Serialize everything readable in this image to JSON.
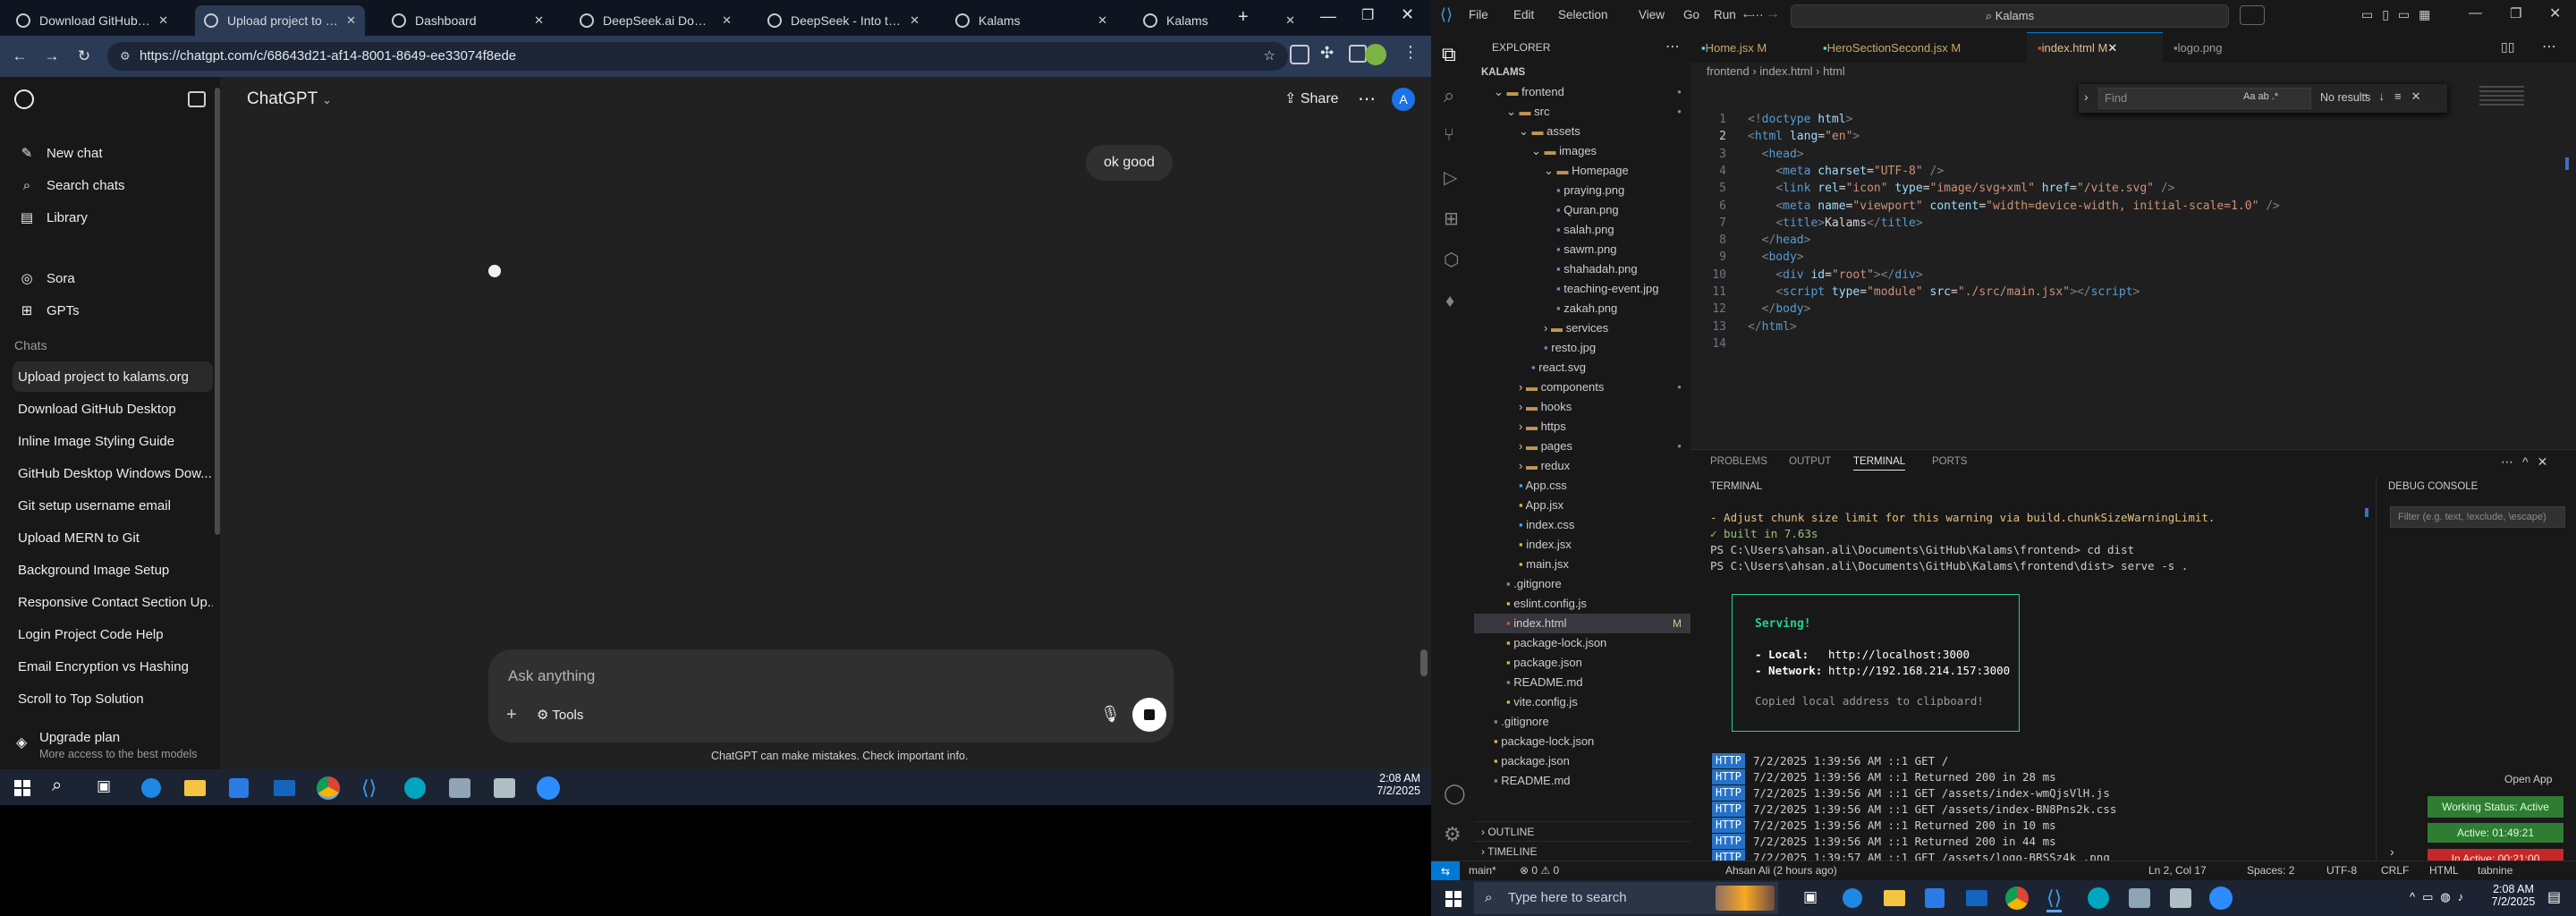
{
  "browser": {
    "tabs": [
      {
        "title": "Download GitHub Des"
      },
      {
        "title": "Upload project to kala",
        "active": true
      },
      {
        "title": "Dashboard"
      },
      {
        "title": "DeepSeek.ai Domain F"
      },
      {
        "title": "DeepSeek - Into the U"
      },
      {
        "title": "Kalams"
      },
      {
        "title": "Kalams"
      }
    ],
    "url": "https://chatgpt.com/c/68643d21-af14-8001-8649-ee33074f8ede"
  },
  "chatgpt": {
    "sidebar_top": [
      {
        "label": "New chat",
        "icon": "✎"
      },
      {
        "label": "Search chats",
        "icon": "⌕"
      },
      {
        "label": "Library",
        "icon": "▤"
      }
    ],
    "sidebar_mid": [
      {
        "label": "Sora",
        "icon": "◎"
      },
      {
        "label": "GPTs",
        "icon": "⊞"
      }
    ],
    "chats_heading": "Chats",
    "chats": [
      "Upload project to kalams.org",
      "Download GitHub Desktop",
      "Inline Image Styling Guide",
      "GitHub Desktop Windows Dow...",
      "Git setup username email",
      "Upload MERN to Git",
      "Background Image Setup",
      "Responsive Contact Section Up...",
      "Login Project Code Help",
      "Email Encryption vs Hashing",
      "Scroll to Top Solution"
    ],
    "upgrade_title": "Upgrade plan",
    "upgrade_sub": "More access to the best models",
    "model": "ChatGPT",
    "share": "Share",
    "avatar": "A",
    "user_message": "ok good",
    "input_placeholder": "Ask anything",
    "tools": "Tools",
    "disclaimer": "ChatGPT can make mistakes. Check important info."
  },
  "taskbar_left": {
    "time": "2:08 AM",
    "date": "7/2/2025"
  },
  "vscode": {
    "menu": [
      "File",
      "Edit",
      "Selection",
      "View",
      "Go",
      "Run",
      "···"
    ],
    "search": "Kalams",
    "explorer_title": "EXPLORER",
    "tabs": [
      {
        "label": "Home.jsx M"
      },
      {
        "label": "HeroSectionSecond.jsx M"
      },
      {
        "label": "index.html M",
        "active": true
      },
      {
        "label": "logo.png"
      }
    ],
    "breadcrumb": [
      "frontend",
      "index.html",
      "html"
    ],
    "find_placeholder": "Find",
    "find_result": "No results",
    "tree": [
      {
        "label": "KALAMS",
        "indent": 0,
        "arrow": "",
        "bold": true
      },
      {
        "label": "frontend",
        "indent": 1,
        "arrow": "v",
        "dot": true
      },
      {
        "label": "src",
        "indent": 2,
        "arrow": "v",
        "dot": true
      },
      {
        "label": "assets",
        "indent": 3,
        "arrow": "v"
      },
      {
        "label": "images",
        "indent": 4,
        "arrow": "v"
      },
      {
        "label": "Homepage",
        "indent": 5,
        "arrow": "v"
      },
      {
        "label": "praying.png",
        "indent": 6
      },
      {
        "label": "Quran.png",
        "indent": 6
      },
      {
        "label": "salah.png",
        "indent": 6
      },
      {
        "label": "sawm.png",
        "indent": 6
      },
      {
        "label": "shahadah.png",
        "indent": 6
      },
      {
        "label": "teaching-event.jpg",
        "indent": 6
      },
      {
        "label": "zakah.png",
        "indent": 6
      },
      {
        "label": "services",
        "indent": 5,
        "arrow": ">"
      },
      {
        "label": "resto.jpg",
        "indent": 5
      },
      {
        "label": "react.svg",
        "indent": 4
      },
      {
        "label": "components",
        "indent": 3,
        "arrow": ">",
        "dot": true
      },
      {
        "label": "hooks",
        "indent": 3,
        "arrow": ">"
      },
      {
        "label": "https",
        "indent": 3,
        "arrow": ">"
      },
      {
        "label": "pages",
        "indent": 3,
        "arrow": ">",
        "dot": true
      },
      {
        "label": "redux",
        "indent": 3,
        "arrow": ">"
      },
      {
        "label": "App.css",
        "indent": 3
      },
      {
        "label": "App.jsx",
        "indent": 3
      },
      {
        "label": "index.css",
        "indent": 3
      },
      {
        "label": "index.jsx",
        "indent": 3
      },
      {
        "label": "main.jsx",
        "indent": 3
      },
      {
        "label": ".gitignore",
        "indent": 2
      },
      {
        "label": "eslint.config.js",
        "indent": 2
      },
      {
        "label": "index.html",
        "indent": 2,
        "mark": "M",
        "selected": true
      },
      {
        "label": "package-lock.json",
        "indent": 2
      },
      {
        "label": "package.json",
        "indent": 2
      },
      {
        "label": "README.md",
        "indent": 2
      },
      {
        "label": "vite.config.js",
        "indent": 2
      },
      {
        "label": ".gitignore",
        "indent": 1
      },
      {
        "label": "package-lock.json",
        "indent": 1
      },
      {
        "label": "package.json",
        "indent": 1
      },
      {
        "label": "README.md",
        "indent": 1
      }
    ],
    "outline": "OUTLINE",
    "timeline": "TIMELINE",
    "code_lines": [
      [
        [
          "pu",
          "<!"
        ],
        [
          "tg",
          "doctype"
        ],
        [
          "at",
          " html"
        ],
        [
          "pu",
          ">"
        ]
      ],
      [
        [
          "pu",
          "<"
        ],
        [
          "tg",
          "html"
        ],
        [
          "at",
          " lang"
        ],
        [
          "tx",
          "="
        ],
        [
          "st",
          "\"en\""
        ],
        [
          "pu",
          ">"
        ]
      ],
      [
        [
          "tx",
          "  "
        ],
        [
          "pu",
          "<"
        ],
        [
          "tg",
          "head"
        ],
        [
          "pu",
          ">"
        ]
      ],
      [
        [
          "tx",
          "    "
        ],
        [
          "pu",
          "<"
        ],
        [
          "tg",
          "meta"
        ],
        [
          "at",
          " charset"
        ],
        [
          "tx",
          "="
        ],
        [
          "st",
          "\"UTF-8\""
        ],
        [
          "pu",
          " />"
        ]
      ],
      [
        [
          "tx",
          "    "
        ],
        [
          "pu",
          "<"
        ],
        [
          "tg",
          "link"
        ],
        [
          "at",
          " rel"
        ],
        [
          "tx",
          "="
        ],
        [
          "st",
          "\"icon\""
        ],
        [
          "at",
          " type"
        ],
        [
          "tx",
          "="
        ],
        [
          "st",
          "\"image/svg+xml\""
        ],
        [
          "at",
          " href"
        ],
        [
          "tx",
          "="
        ],
        [
          "st",
          "\"/vite.svg\""
        ],
        [
          "pu",
          " />"
        ]
      ],
      [
        [
          "tx",
          "    "
        ],
        [
          "pu",
          "<"
        ],
        [
          "tg",
          "meta"
        ],
        [
          "at",
          " name"
        ],
        [
          "tx",
          "="
        ],
        [
          "st",
          "\"viewport\""
        ],
        [
          "at",
          " content"
        ],
        [
          "tx",
          "="
        ],
        [
          "st",
          "\"width=device-width, initial-scale=1.0\""
        ],
        [
          "pu",
          " />"
        ]
      ],
      [
        [
          "tx",
          "    "
        ],
        [
          "pu",
          "<"
        ],
        [
          "tg",
          "title"
        ],
        [
          "pu",
          ">"
        ],
        [
          "tx",
          "Kalams"
        ],
        [
          "pu",
          "</"
        ],
        [
          "tg",
          "title"
        ],
        [
          "pu",
          ">"
        ]
      ],
      [
        [
          "tx",
          "  "
        ],
        [
          "pu",
          "</"
        ],
        [
          "tg",
          "head"
        ],
        [
          "pu",
          ">"
        ]
      ],
      [
        [
          "tx",
          "  "
        ],
        [
          "pu",
          "<"
        ],
        [
          "tg",
          "body"
        ],
        [
          "pu",
          ">"
        ]
      ],
      [
        [
          "tx",
          "    "
        ],
        [
          "pu",
          "<"
        ],
        [
          "tg",
          "div"
        ],
        [
          "at",
          " id"
        ],
        [
          "tx",
          "="
        ],
        [
          "st",
          "\"root\""
        ],
        [
          "pu",
          "></"
        ],
        [
          "tg",
          "div"
        ],
        [
          "pu",
          ">"
        ]
      ],
      [
        [
          "tx",
          "    "
        ],
        [
          "pu",
          "<"
        ],
        [
          "tg",
          "script"
        ],
        [
          "at",
          " type"
        ],
        [
          "tx",
          "="
        ],
        [
          "st",
          "\"module\""
        ],
        [
          "at",
          " src"
        ],
        [
          "tx",
          "="
        ],
        [
          "st",
          "\"./src/main.jsx\""
        ],
        [
          "pu",
          "></"
        ],
        [
          "tg",
          "script"
        ],
        [
          "pu",
          ">"
        ]
      ],
      [
        [
          "tx",
          "  "
        ],
        [
          "pu",
          "</"
        ],
        [
          "tg",
          "body"
        ],
        [
          "pu",
          ">"
        ]
      ],
      [
        [
          "pu",
          "</"
        ],
        [
          "tg",
          "html"
        ],
        [
          "pu",
          ">"
        ]
      ],
      []
    ],
    "panel_tabs": [
      "PROBLEMS",
      "OUTPUT",
      "TERMINAL",
      "PORTS"
    ],
    "terminal_label": "TERMINAL",
    "debug_label": "DEBUG CONSOLE",
    "debug_filter": "Filter (e.g. text, !exclude, \\escape)",
    "terminal_lines": [
      {
        "text": "- Adjust chunk size limit for this warning via build.chunkSizeWarningLimit.",
        "color": "#e5c07b"
      },
      {
        "text": "✓ built in 7.63s",
        "color": "#98c379"
      },
      {
        "text": "PS C:\\Users\\ahsan.ali\\Documents\\GitHub\\Kalams\\frontend> cd dist",
        "color": "#cccccc"
      },
      {
        "text": "PS C:\\Users\\ahsan.ali\\Documents\\GitHub\\Kalams\\frontend\\dist> serve -s .",
        "color": "#cccccc"
      }
    ],
    "serve_box": {
      "title": "Serving!",
      "local_label": "- Local:",
      "local_url": "http://localhost:3000",
      "network_label": "- Network:",
      "network_url": "http://192.168.214.157:3000",
      "copied": "Copied local address to clipboard!"
    },
    "http_lines": [
      "7/2/2025 1:39:56 AM ::1 GET /",
      "7/2/2025 1:39:56 AM ::1 Returned 200 in 28 ms",
      "7/2/2025 1:39:56 AM ::1 GET /assets/index-wmQjsVlH.js",
      "7/2/2025 1:39:56 AM ::1 GET /assets/index-BN8Pns2k.css",
      "7/2/2025 1:39:56 AM ::1 Returned 200 in 10 ms",
      "7/2/2025 1:39:56 AM ::1 Returned 200 in 44 ms",
      "7/2/2025 1:39:57 AM ::1 GET /assets/logo-BRSSz4k_.png"
    ],
    "http_badge": "HTTP",
    "open_app": "Open App",
    "working_status": "Working Status: Active",
    "active_time": "Active: 01:49:21",
    "inactive_time": "In Active: 00:21:00",
    "status_left": [
      "main*",
      "⊗ 0 ⚠ 0",
      "Ahsan Ali (2 hours ago)"
    ],
    "status_right": [
      "Ln 2, Col 17",
      "Spaces: 2",
      "UTF-8",
      "CRLF",
      "HTML",
      "tabnine"
    ]
  },
  "taskbar_right": {
    "search_placeholder": "Type here to search",
    "time": "2:08 AM",
    "date": "7/2/2025"
  }
}
